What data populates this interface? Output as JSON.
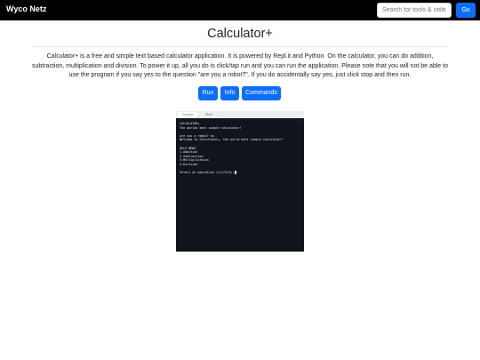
{
  "navbar": {
    "brand": "Wyco Netz",
    "search_placeholder": "Search for tools & utilities",
    "go_label": "Go"
  },
  "page": {
    "title": "Calculator+",
    "description": "Calculator+ is a free and simple text based calculator application. It is powered by Repl.it and Python. On the calculator, you can do addition, subtraction, multiplication and division. To power it up, all you do is click/tap run and you can run the application. Please note that you will not be able to use the program if you say yes to the question \"are you a robot?\". If you do accidentally say yes, just click stop and then run."
  },
  "actions": {
    "run": "Run",
    "info": "Info",
    "commands": "Commands"
  },
  "preview": {
    "tabs": [
      "Console",
      "Shell"
    ],
    "window_controls": "– ×",
    "console_lines": [
      "CALCULATOR+",
      "The worlds best simple calculator!",
      "",
      "Are you a robot? no",
      "Welcome to Calculator+, the world best simple calculator!",
      "",
      "HELP MENU",
      "1.Addition",
      "2.Subtraction",
      "3.Multiplication",
      "4.Division",
      "",
      "Select an operation (1/2/3/4):"
    ]
  },
  "colors": {
    "navbar": "#000000",
    "primary": "#0d6efd",
    "console_bg": "#12141d"
  }
}
